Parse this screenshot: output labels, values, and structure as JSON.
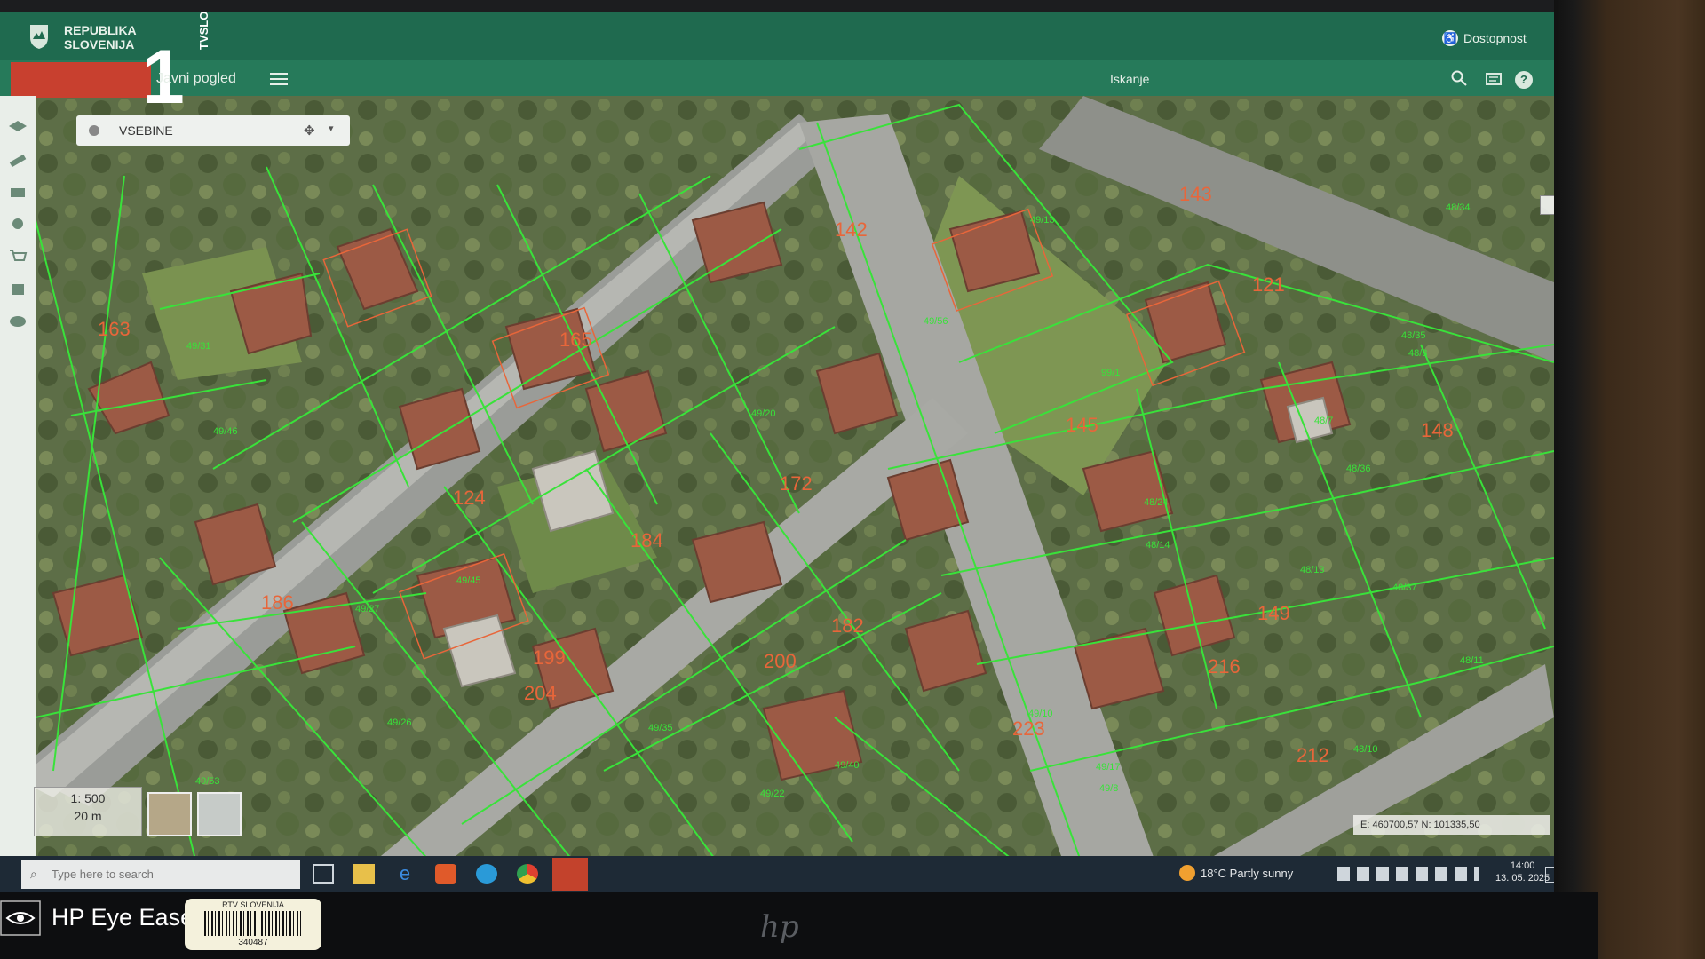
{
  "header": {
    "logo_line1": "REPUBLIKA",
    "logo_line2": "SLOVENIJA",
    "accessibility_label": "Dostopnost",
    "view_mode": "Javni pogled",
    "search_placeholder": "Iskanje"
  },
  "overlay": {
    "channel_number": "1",
    "channel_name": "TVSLO"
  },
  "map": {
    "contents_dropdown": "VSEBINE",
    "scale_ratio": "1: 500",
    "scale_distance": "20 m",
    "coordinates": "E: 460700,57  N: 101335,50",
    "building_numbers": [
      "163",
      "165",
      "143",
      "142",
      "121",
      "124",
      "172",
      "184",
      "186",
      "200",
      "182",
      "145",
      "148",
      "149",
      "199",
      "204",
      "212",
      "223",
      "216"
    ],
    "parcel_numbers": [
      "49/31",
      "49/46",
      "49/45",
      "49/27",
      "49/20",
      "49/26",
      "49/35",
      "49/22",
      "49/53",
      "49/56",
      "49/8",
      "49/13",
      "49/40",
      "49/10",
      "49/17",
      "48/35",
      "48/37",
      "48/14",
      "48/24",
      "48/13",
      "48/11",
      "48/7",
      "99/1",
      "48/36",
      "48/3",
      "48/34",
      "48/10"
    ]
  },
  "taskbar": {
    "search_placeholder": "Type here to search",
    "weather": "18°C  Partly sunny",
    "time": "14:00",
    "date": "13. 05. 2025"
  },
  "monitor": {
    "eye_ease_label": "HP Eye Ease",
    "badge_top": "RTV SLOVENIJA",
    "badge_number": "340487",
    "brand": "hp"
  },
  "colors": {
    "header": "#1f6a4f",
    "parcel_line": "#39e23a",
    "label_building": "#e8663a",
    "channel_badge": "#c8402f"
  }
}
